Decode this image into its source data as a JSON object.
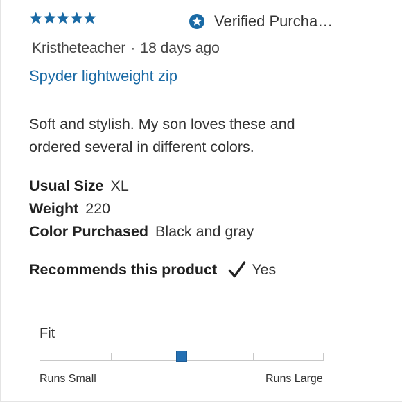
{
  "review": {
    "rating": 5,
    "rating_max": 5,
    "star_color": "#1a6aa5",
    "verified_icon": "verified-star-icon",
    "verified_label": "Verified Purcha…",
    "author": "Kristheteacher",
    "separator": "·",
    "date": "18 days ago",
    "title": "Spyder lightweight zip",
    "title_color": "#1a6aa5",
    "body": "Soft and stylish. My son loves these and ordered several in different colors.",
    "attributes": [
      {
        "label": "Usual Size",
        "value": "XL"
      },
      {
        "label": "Weight",
        "value": "220"
      },
      {
        "label": "Color Purchased",
        "value": "Black and gray"
      }
    ],
    "recommend_label": "Recommends this product",
    "recommend_icon": "check-icon",
    "recommend_value": "Yes"
  },
  "fit": {
    "label": "Fit",
    "min_label": "Runs Small",
    "max_label": "Runs Large",
    "segments": 4,
    "value_fraction": 0.5,
    "marker_color": "#2470b3"
  }
}
